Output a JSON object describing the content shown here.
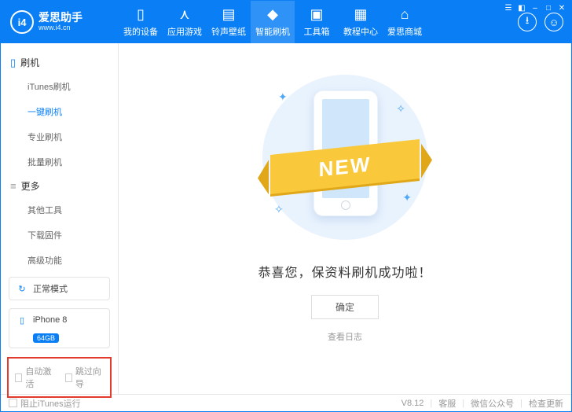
{
  "logo": {
    "badge": "i4",
    "title": "爱思助手",
    "subtitle": "www.i4.cn"
  },
  "nav": [
    {
      "label": "我的设备"
    },
    {
      "label": "应用游戏"
    },
    {
      "label": "铃声壁纸"
    },
    {
      "label": "智能刷机"
    },
    {
      "label": "工具箱"
    },
    {
      "label": "教程中心"
    },
    {
      "label": "爱思商城"
    }
  ],
  "sidebar": {
    "sec1": {
      "title": "刷机",
      "items": [
        "iTunes刷机",
        "一键刷机",
        "专业刷机",
        "批量刷机"
      ]
    },
    "sec2": {
      "title": "更多",
      "items": [
        "其他工具",
        "下载固件",
        "高级功能"
      ]
    },
    "mode": {
      "label": "正常模式"
    },
    "device": {
      "name": "iPhone 8",
      "storage": "64GB"
    },
    "opts": [
      "自动激活",
      "跳过向导"
    ]
  },
  "main": {
    "ribbon": "NEW",
    "message": "恭喜您，保资料刷机成功啦！",
    "ok": "确定",
    "log": "查看日志"
  },
  "footer": {
    "block": "阻止iTunes运行",
    "version": "V8.12",
    "links": [
      "客服",
      "微信公众号",
      "检查更新"
    ]
  }
}
